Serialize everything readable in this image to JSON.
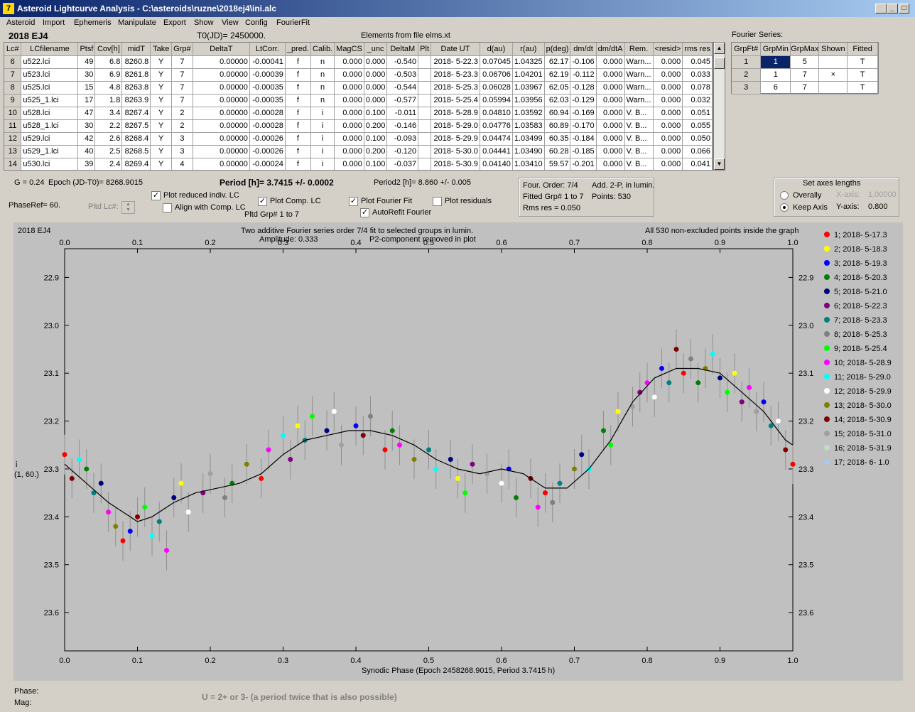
{
  "window": {
    "title": "Asteroid Lightcurve Analysis - C:\\asteroids\\ruzne\\2018ej4\\ini.alc",
    "icon": "app-icon",
    "buttons": [
      "_",
      "□",
      "×"
    ]
  },
  "menu": [
    "Asteroid",
    "Import",
    "Ephemeris",
    "Manipulate",
    "Export",
    "Show",
    "View",
    "Config",
    "FourierFit"
  ],
  "header": {
    "asteroid": "2018 EJ4",
    "t0": "T0(JD)= 2450000.",
    "elements": "Elements from file elms.xt",
    "fourier_label": "Fourier Series:"
  },
  "table": {
    "columns": [
      "Lc#",
      "LCfilename",
      "Ptsf",
      "Cov[h]",
      "midT",
      "Take",
      "Grp#",
      "DeltaT",
      "LtCorr.",
      "_pred.",
      "Calib.",
      "MagCS",
      "_unc",
      "DeltaM",
      "Plt",
      "Date UT",
      "d(au)",
      "r(au)",
      "p(deg)",
      "dm/dt",
      "dm/dtA",
      "Rem.",
      "<resid>",
      "rms res"
    ],
    "rows": [
      [
        "6",
        "u522.lci",
        "49",
        "6.8",
        "8260.8",
        "Y",
        "7",
        "0.00000",
        "-0.00041",
        "f",
        "n",
        "0.000",
        "0.000",
        "-0.540",
        "",
        "2018- 5-22.3",
        "0.07045",
        "1.04325",
        "62.17",
        "-0.106",
        "0.000",
        "Warn...",
        "0.000",
        "0.045"
      ],
      [
        "7",
        "u523.lci",
        "30",
        "6.9",
        "8261.8",
        "Y",
        "7",
        "0.00000",
        "-0.00039",
        "f",
        "n",
        "0.000",
        "0.000",
        "-0.503",
        "",
        "2018- 5-23.3",
        "0.06706",
        "1.04201",
        "62.19",
        "-0.112",
        "0.000",
        "Warn...",
        "0.000",
        "0.033"
      ],
      [
        "8",
        "u525.lci",
        "15",
        "4.8",
        "8263.8",
        "Y",
        "7",
        "0.00000",
        "-0.00035",
        "f",
        "n",
        "0.000",
        "0.000",
        "-0.544",
        "",
        "2018- 5-25.3",
        "0.06028",
        "1.03967",
        "62.05",
        "-0.128",
        "0.000",
        "Warn...",
        "0.000",
        "0.078"
      ],
      [
        "9",
        "u525_1.lci",
        "17",
        "1.8",
        "8263.9",
        "Y",
        "7",
        "0.00000",
        "-0.00035",
        "f",
        "n",
        "0.000",
        "0.000",
        "-0.577",
        "",
        "2018- 5-25.4",
        "0.05994",
        "1.03956",
        "62.03",
        "-0.129",
        "0.000",
        "Warn...",
        "0.000",
        "0.032"
      ],
      [
        "10",
        "u528.lci",
        "47",
        "3.4",
        "8267.4",
        "Y",
        "2",
        "0.00000",
        "-0.00028",
        "f",
        "i",
        "0.000",
        "0.100",
        "-0.011",
        "",
        "2018- 5-28.9",
        "0.04810",
        "1.03592",
        "60.94",
        "-0.169",
        "0.000",
        "V. B...",
        "0.000",
        "0.051"
      ],
      [
        "11",
        "u528_1.lci",
        "30",
        "2.2",
        "8267.5",
        "Y",
        "2",
        "0.00000",
        "-0.00028",
        "f",
        "i",
        "0.000",
        "0.200",
        "-0.146",
        "",
        "2018- 5-29.0",
        "0.04776",
        "1.03583",
        "60.89",
        "-0.170",
        "0.000",
        "V. B...",
        "0.000",
        "0.055"
      ],
      [
        "12",
        "u529.lci",
        "42",
        "2.6",
        "8268.4",
        "Y",
        "3",
        "0.00000",
        "-0.00026",
        "f",
        "i",
        "0.000",
        "0.100",
        "-0.093",
        "",
        "2018- 5-29.9",
        "0.04474",
        "1.03499",
        "60.35",
        "-0.184",
        "0.000",
        "V. B...",
        "0.000",
        "0.050"
      ],
      [
        "13",
        "u529_1.lci",
        "40",
        "2.5",
        "8268.5",
        "Y",
        "3",
        "0.00000",
        "-0.00026",
        "f",
        "i",
        "0.000",
        "0.200",
        "-0.120",
        "",
        "2018- 5-30.0",
        "0.04441",
        "1.03490",
        "60.28",
        "-0.185",
        "0.000",
        "V. B...",
        "0.000",
        "0.066"
      ],
      [
        "14",
        "u530.lci",
        "39",
        "2.4",
        "8269.4",
        "Y",
        "4",
        "0.00000",
        "-0.00024",
        "f",
        "i",
        "0.000",
        "0.100",
        "-0.037",
        "",
        "2018- 5-30.9",
        "0.04140",
        "1.03410",
        "59.57",
        "-0.201",
        "0.000",
        "V. B...",
        "0.000",
        "0.041"
      ]
    ]
  },
  "fourier_table": {
    "columns": [
      "GrpFt#",
      "GrpMin",
      "GrpMax",
      "Shown",
      "Fitted"
    ],
    "rows": [
      [
        "1",
        "1",
        "5",
        "",
        "T"
      ],
      [
        "2",
        "1",
        "7",
        "×",
        "T"
      ],
      [
        "3",
        "6",
        "7",
        "",
        "T"
      ]
    ]
  },
  "controls": {
    "g": "G = 0.24",
    "epoch": "Epoch (JD-T0)= 8268.9015",
    "period": "Period [h]= 3.7415 +/- 0.0002",
    "period2": "Period2 [h]= 8.860 +/- 0.005",
    "phaseref": "PhaseRef= 60.",
    "pltd_lc": "Pltd Lc#:",
    "plot_reduced": "Plot reduced indiv. LC",
    "align": "Align with Comp. LC",
    "plot_comp": "Plot Comp. LC",
    "pltd_grp": "Pltd Grp#  1   to   7",
    "plot_fourier": "Plot Fourier Fit",
    "autorefit": "AutoRefit Fourier",
    "plot_residuals": "Plot residuals"
  },
  "fourier_info": {
    "order": "Four. Order:  7/4",
    "add": "Add. 2-P, in lumin.",
    "fitted": "Fitted Grp# 1 to 7",
    "points": "Points: 530",
    "rms": "Rms res      = 0.050"
  },
  "axes_box": {
    "title": "Set axes lengths",
    "overally": "Overally",
    "keep": "Keep Axis",
    "xaxis_label": "X-axis:",
    "xaxis_val": "1.00000",
    "yaxis_label": "Y-axis:",
    "yaxis_val": "0.800"
  },
  "plot": {
    "name": "2018 EJ4",
    "line1": "Two additive Fourier series order 7/4 fit to selected groups in lumin.",
    "line2": "Amplitude: 0.333",
    "line3": "P2-component removed in plot",
    "right_note": "All 530 non-excluded points inside the graph",
    "ylabel1": "i",
    "ylabel2": "(1, 60.)"
  },
  "chart_data": {
    "type": "scatter",
    "xlabel": "Synodic Phase (Epoch 2458268.9015, Period 3.7415 h)",
    "xlim": [
      0,
      1
    ],
    "ylim": [
      23.3,
      22.84
    ],
    "y_inverted": true,
    "xticks": [
      "0.0",
      "0.1",
      "0.2",
      "0.3",
      "0.4",
      "0.5",
      "0.6",
      "0.7",
      "0.8",
      "0.9",
      "1.0"
    ],
    "yticks": [
      "22.9",
      "23.0",
      "23.1",
      "23.2",
      "23.3",
      "23.4",
      "23.5",
      "23.6"
    ],
    "ytick_values": [
      22.9,
      23.0,
      23.1,
      23.2,
      23.3,
      23.4,
      23.5,
      23.6
    ],
    "fourier_curve": {
      "x": [
        0,
        0.03,
        0.06,
        0.09,
        0.1,
        0.12,
        0.15,
        0.18,
        0.21,
        0.24,
        0.27,
        0.3,
        0.33,
        0.36,
        0.39,
        0.42,
        0.45,
        0.48,
        0.51,
        0.54,
        0.57,
        0.6,
        0.63,
        0.66,
        0.69,
        0.72,
        0.75,
        0.78,
        0.81,
        0.84,
        0.87,
        0.9,
        0.93,
        0.96,
        0.99,
        1.0
      ],
      "y": [
        23.29,
        23.33,
        23.37,
        23.4,
        23.41,
        23.4,
        23.37,
        23.35,
        23.34,
        23.33,
        23.31,
        23.27,
        23.24,
        23.23,
        23.22,
        23.22,
        23.23,
        23.25,
        23.28,
        23.3,
        23.31,
        23.3,
        23.31,
        23.34,
        23.34,
        23.3,
        23.24,
        23.16,
        23.11,
        23.09,
        23.09,
        23.1,
        23.14,
        23.18,
        23.24,
        23.25
      ]
    },
    "legend": [
      {
        "label": "1; 2018- 5-17.3",
        "color": "#ff0000"
      },
      {
        "label": "2; 2018- 5-18.3",
        "color": "#ffff00"
      },
      {
        "label": "3; 2018- 5-19.3",
        "color": "#0000ff"
      },
      {
        "label": "4; 2018- 5-20.3",
        "color": "#008000"
      },
      {
        "label": "5; 2018- 5-21.0",
        "color": "#000080"
      },
      {
        "label": "6; 2018- 5-22.3",
        "color": "#800080"
      },
      {
        "label": "7; 2018- 5-23.3",
        "color": "#008080"
      },
      {
        "label": "8; 2018- 5-25.3",
        "color": "#808080"
      },
      {
        "label": "9; 2018- 5-25.4",
        "color": "#00ff00"
      },
      {
        "label": "10; 2018- 5-28.9",
        "color": "#ff00ff"
      },
      {
        "label": "11; 2018- 5-29.0",
        "color": "#00ffff"
      },
      {
        "label": "12; 2018- 5-29.9",
        "color": "#ffffff"
      },
      {
        "label": "13; 2018- 5-30.0",
        "color": "#808000"
      },
      {
        "label": "14; 2018- 5-30.9",
        "color": "#800000"
      },
      {
        "label": "15; 2018- 5-31.0",
        "color": "#a0a0a0"
      },
      {
        "label": "16; 2018- 5-31.9",
        "color": "#c0dcc0"
      },
      {
        "label": "17; 2018- 6- 1.0",
        "color": "#a6caf0"
      }
    ],
    "points": [
      [
        0.0,
        23.27,
        0
      ],
      [
        0.01,
        23.32,
        13
      ],
      [
        0.02,
        23.28,
        10
      ],
      [
        0.03,
        23.3,
        3
      ],
      [
        0.04,
        23.35,
        6
      ],
      [
        0.05,
        23.33,
        4
      ],
      [
        0.06,
        23.39,
        9
      ],
      [
        0.07,
        23.42,
        12
      ],
      [
        0.08,
        23.45,
        0
      ],
      [
        0.09,
        23.43,
        2
      ],
      [
        0.1,
        23.4,
        13
      ],
      [
        0.11,
        23.38,
        8
      ],
      [
        0.12,
        23.44,
        10
      ],
      [
        0.13,
        23.41,
        6
      ],
      [
        0.14,
        23.47,
        9
      ],
      [
        0.15,
        23.36,
        4
      ],
      [
        0.16,
        23.33,
        1
      ],
      [
        0.17,
        23.39,
        11
      ],
      [
        0.19,
        23.35,
        5
      ],
      [
        0.2,
        23.31,
        14
      ],
      [
        0.22,
        23.36,
        7
      ],
      [
        0.23,
        23.33,
        3
      ],
      [
        0.25,
        23.29,
        12
      ],
      [
        0.27,
        23.32,
        0
      ],
      [
        0.28,
        23.26,
        9
      ],
      [
        0.3,
        23.23,
        10
      ],
      [
        0.31,
        23.28,
        5
      ],
      [
        0.32,
        23.21,
        1
      ],
      [
        0.33,
        23.24,
        6
      ],
      [
        0.34,
        23.19,
        8
      ],
      [
        0.36,
        23.22,
        4
      ],
      [
        0.37,
        23.18,
        11
      ],
      [
        0.38,
        23.25,
        14
      ],
      [
        0.4,
        23.21,
        2
      ],
      [
        0.41,
        23.23,
        13
      ],
      [
        0.42,
        23.19,
        7
      ],
      [
        0.44,
        23.26,
        0
      ],
      [
        0.45,
        23.22,
        3
      ],
      [
        0.46,
        23.25,
        9
      ],
      [
        0.48,
        23.28,
        12
      ],
      [
        0.5,
        23.26,
        6
      ],
      [
        0.51,
        23.3,
        10
      ],
      [
        0.53,
        23.28,
        4
      ],
      [
        0.54,
        23.32,
        1
      ],
      [
        0.55,
        23.35,
        8
      ],
      [
        0.56,
        23.29,
        5
      ],
      [
        0.58,
        23.31,
        14
      ],
      [
        0.6,
        23.33,
        11
      ],
      [
        0.61,
        23.3,
        2
      ],
      [
        0.62,
        23.36,
        3
      ],
      [
        0.64,
        23.32,
        13
      ],
      [
        0.65,
        23.38,
        9
      ],
      [
        0.66,
        23.35,
        0
      ],
      [
        0.67,
        23.37,
        7
      ],
      [
        0.68,
        23.33,
        6
      ],
      [
        0.7,
        23.3,
        12
      ],
      [
        0.71,
        23.27,
        4
      ],
      [
        0.72,
        23.3,
        10
      ],
      [
        0.74,
        23.22,
        3
      ],
      [
        0.75,
        23.25,
        8
      ],
      [
        0.76,
        23.18,
        1
      ],
      [
        0.78,
        23.17,
        14
      ],
      [
        0.79,
        23.14,
        5
      ],
      [
        0.8,
        23.12,
        9
      ],
      [
        0.81,
        23.15,
        11
      ],
      [
        0.82,
        23.09,
        2
      ],
      [
        0.83,
        23.12,
        6
      ],
      [
        0.84,
        23.05,
        13
      ],
      [
        0.85,
        23.1,
        0
      ],
      [
        0.86,
        23.07,
        7
      ],
      [
        0.87,
        23.12,
        3
      ],
      [
        0.88,
        23.09,
        12
      ],
      [
        0.89,
        23.06,
        10
      ],
      [
        0.9,
        23.11,
        4
      ],
      [
        0.91,
        23.14,
        8
      ],
      [
        0.92,
        23.1,
        1
      ],
      [
        0.93,
        23.16,
        5
      ],
      [
        0.94,
        23.13,
        9
      ],
      [
        0.95,
        23.18,
        14
      ],
      [
        0.96,
        23.16,
        2
      ],
      [
        0.97,
        23.21,
        6
      ],
      [
        0.98,
        23.2,
        11
      ],
      [
        0.99,
        23.26,
        13
      ],
      [
        1.0,
        23.29,
        0
      ]
    ]
  },
  "status": {
    "phase": "Phase:",
    "mag": "Mag:",
    "note": "U = 2+ or 3- (a period twice that is also possible)"
  }
}
